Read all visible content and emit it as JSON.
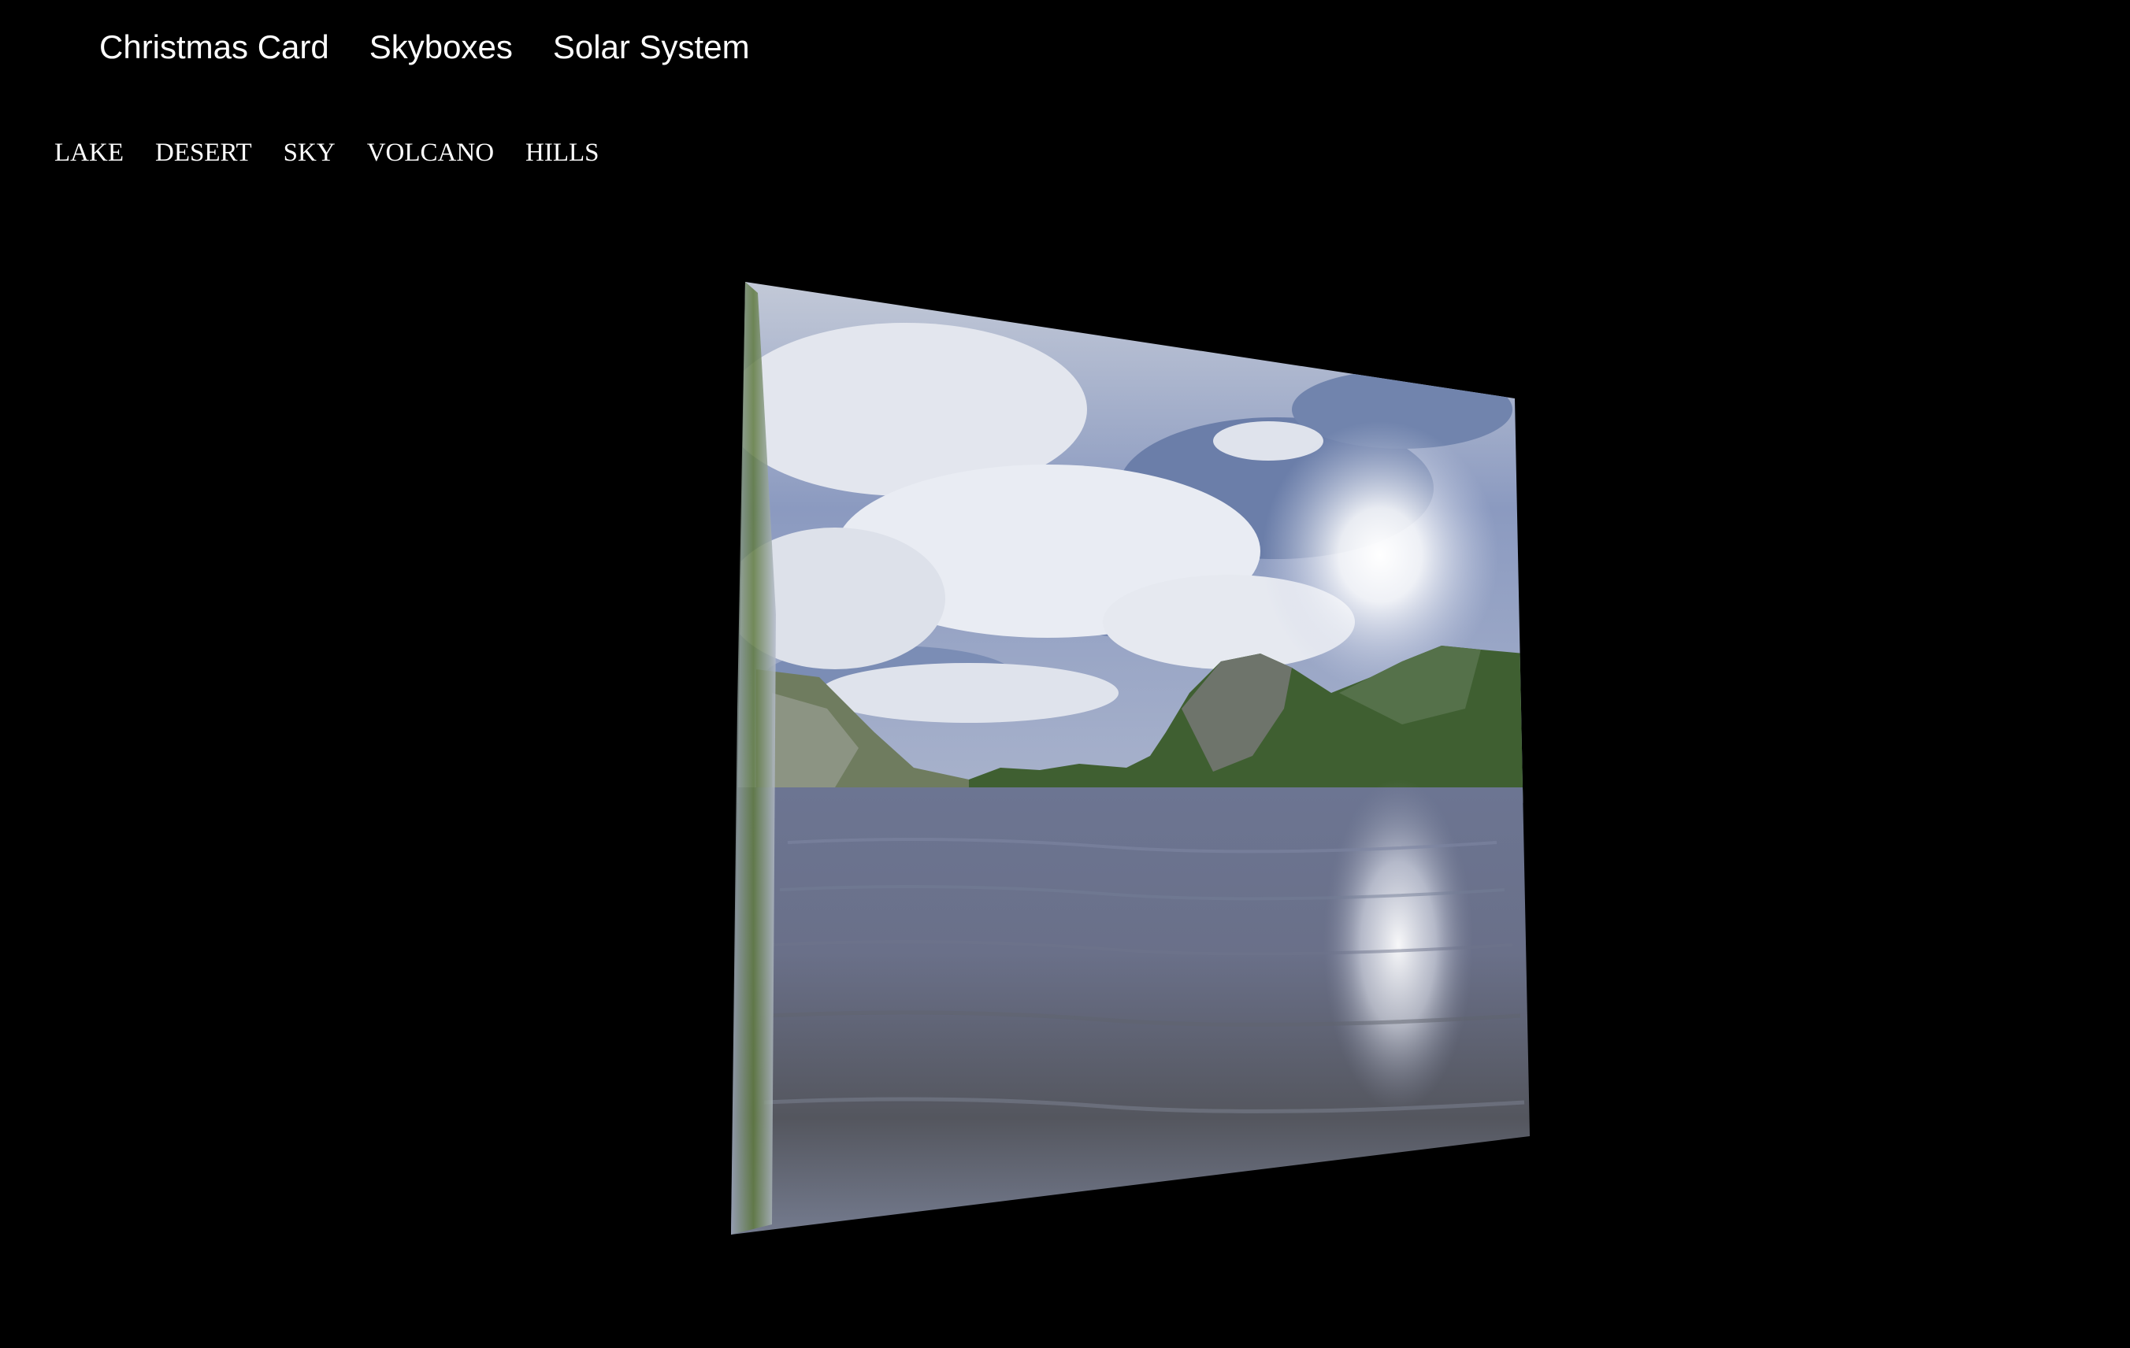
{
  "main_nav": {
    "items": [
      {
        "label": "Christmas Card"
      },
      {
        "label": "Skyboxes"
      },
      {
        "label": "Solar System"
      }
    ]
  },
  "skybox_nav": {
    "items": [
      {
        "label": "LAKE"
      },
      {
        "label": "DESERT"
      },
      {
        "label": "SKY"
      },
      {
        "label": "VOLCANO"
      },
      {
        "label": "HILLS"
      }
    ]
  },
  "scene": {
    "active_skybox": "LAKE",
    "background_color": "#000000",
    "colors": {
      "sky_top": "#b9bfcd",
      "sky_blue": "#6f82ad",
      "cloud": "#e8ebf3",
      "sun": "#ffffff",
      "mountain_dark": "#2f4a2c",
      "mountain_rock": "#8a8f88",
      "forest": "#3f6b2c",
      "water": "#5d6680",
      "water_dark": "#4a4d55",
      "water_glare": "#f3f5fa"
    }
  }
}
